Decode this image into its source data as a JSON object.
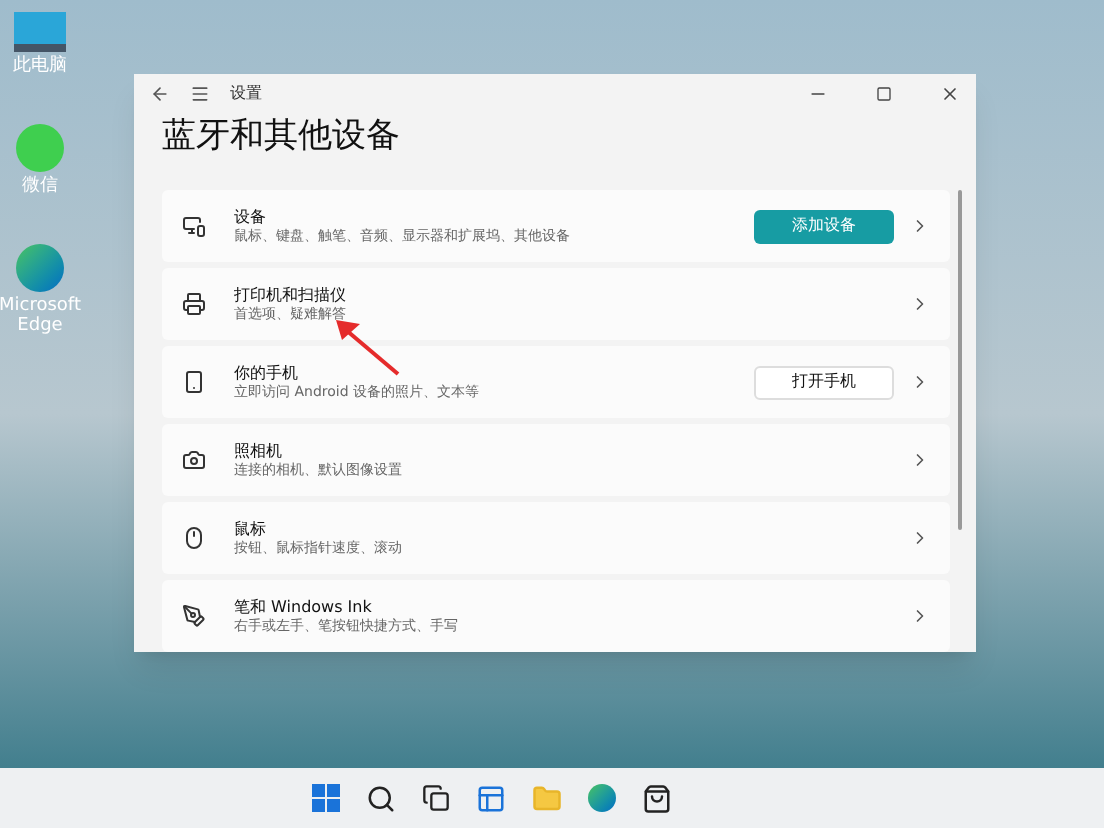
{
  "desktop_icons": [
    {
      "kind": "computer",
      "label": "此电脑"
    },
    {
      "kind": "chat",
      "label": "微信"
    },
    {
      "kind": "browser",
      "label": "Microsoft Edge"
    }
  ],
  "window": {
    "title": "设置",
    "heading": "蓝牙和其他设备",
    "items": [
      {
        "kind": "devices",
        "title": "设备",
        "subtitle": "鼠标、键盘、触笔、音频、显示器和扩展坞、其他设备",
        "button": {
          "label": "添加设备",
          "kind": "accent"
        }
      },
      {
        "kind": "printer",
        "title": "打印机和扫描仪",
        "subtitle": "首选项、疑难解答"
      },
      {
        "kind": "phone",
        "title": "你的手机",
        "subtitle": "立即访问 Android 设备的照片、文本等",
        "button": {
          "label": "打开手机",
          "kind": "plain"
        }
      },
      {
        "kind": "camera",
        "title": "照相机",
        "subtitle": "连接的相机、默认图像设置"
      },
      {
        "kind": "mouse",
        "title": "鼠标",
        "subtitle": "按钮、鼠标指针速度、滚动"
      },
      {
        "kind": "pen",
        "title": "笔和 Windows Ink",
        "subtitle": "右手或左手、笔按钮快捷方式、手写"
      }
    ]
  },
  "taskbar": [
    {
      "kind": "start"
    },
    {
      "kind": "search"
    },
    {
      "kind": "taskview"
    },
    {
      "kind": "widgets"
    },
    {
      "kind": "explorer"
    },
    {
      "kind": "edge"
    },
    {
      "kind": "store"
    }
  ]
}
